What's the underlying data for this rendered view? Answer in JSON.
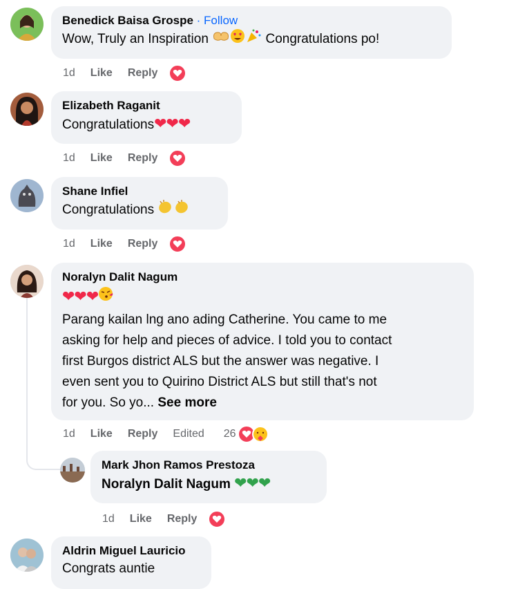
{
  "comments": [
    {
      "name": "Benedick Baisa Grospe",
      "follow": "Follow",
      "text": "Wow, Truly an Inspiration",
      "text_after": "Congratulations po!",
      "time": "1d",
      "like": "Like",
      "reply": "Reply"
    },
    {
      "name": "Elizabeth Raganit",
      "text": "Congratulations",
      "time": "1d",
      "like": "Like",
      "reply": "Reply"
    },
    {
      "name": "Shane Infiel",
      "text": "Congratulations",
      "time": "1d",
      "like": "Like",
      "reply": "Reply"
    },
    {
      "name": "Noralyn Dalit Nagum",
      "lines": [
        "Parang kailan lng ano ading Catherine. You came to me",
        "asking for help and pieces of advice. I told you to contact",
        "first Burgos district ALS but the answer was negative. I",
        "even sent you to Quirino District ALS but still that's not"
      ],
      "last_line": "for you. So yo...",
      "see_more": "See more",
      "time": "1d",
      "like": "Like",
      "reply": "Reply",
      "edited": "Edited",
      "reaction_count": "26"
    },
    {
      "name": "Mark Jhon Ramos Prestoza",
      "mention": "Noralyn Dalit Nagum",
      "time": "1d",
      "like": "Like",
      "reply": "Reply"
    },
    {
      "name": "Aldrin Miguel Lauricio",
      "text": "Congrats auntie"
    }
  ],
  "colors": {
    "bubble": "#f0f2f5",
    "link": "#0866ff",
    "muted": "#65676b",
    "love": "#f33e58"
  },
  "icons": {
    "love_reaction": "heart-reaction-icon",
    "care_reaction": "care-reaction-icon"
  }
}
